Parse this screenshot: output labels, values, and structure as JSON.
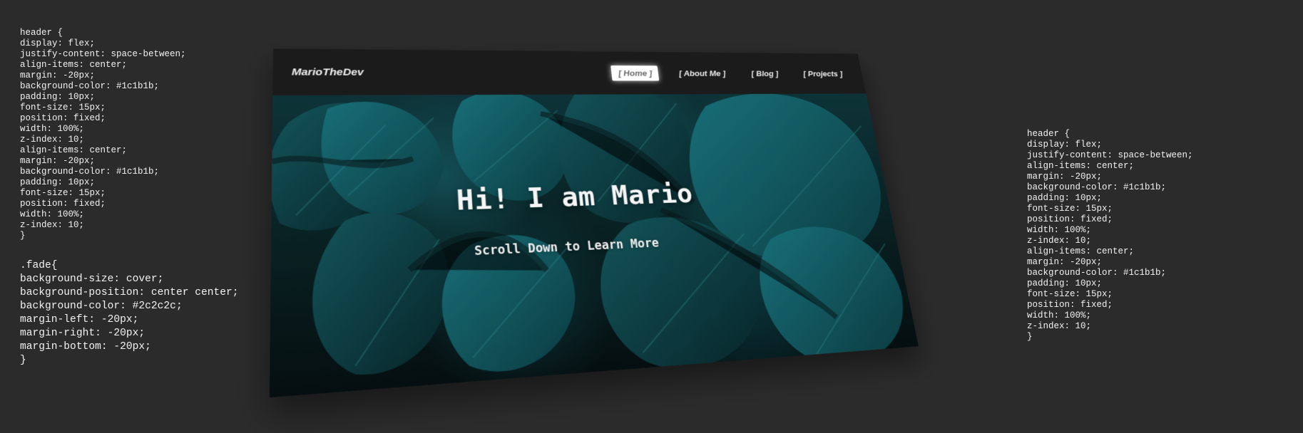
{
  "code_snippets": {
    "left_top": "header {\ndisplay: flex;\njustify-content: space-between;\nalign-items: center;\nmargin: -20px;\nbackground-color: #1c1b1b;\npadding: 10px;\nfont-size: 15px;\nposition: fixed;\nwidth: 100%;\nz-index: 10;\nalign-items: center;\nmargin: -20px;\nbackground-color: #1c1b1b;\npadding: 10px;\nfont-size: 15px;\nposition: fixed;\nwidth: 100%;\nz-index: 10;\n}",
    "left_bottom": ".fade{\nbackground-size: cover;\nbackground-position: center center;\nbackground-color: #2c2c2c;\nmargin-left: -20px;\nmargin-right: -20px;\nmargin-bottom: -20px;\n}",
    "right": "header {\ndisplay: flex;\njustify-content: space-between;\nalign-items: center;\nmargin: -20px;\nbackground-color: #1c1b1b;\npadding: 10px;\nfont-size: 15px;\nposition: fixed;\nwidth: 100%;\nz-index: 10;\nalign-items: center;\nmargin: -20px;\nbackground-color: #1c1b1b;\npadding: 10px;\nfont-size: 15px;\nposition: fixed;\nwidth: 100%;\nz-index: 10;\n}"
  },
  "site": {
    "brand": "MarioTheDev",
    "nav": {
      "home": "[ Home ]",
      "about": "[ About Me ]",
      "blog": "[ Blog ]",
      "projects": "[ Projects ]"
    },
    "hero": {
      "title": "Hi! I am Mario",
      "subtitle": "Scroll Down to Learn More"
    }
  },
  "colors": {
    "page_bg": "#2b2b2b",
    "header_bg": "#1c1b1b",
    "accent_teal": "#1f838f",
    "text": "#f2f2f2"
  }
}
